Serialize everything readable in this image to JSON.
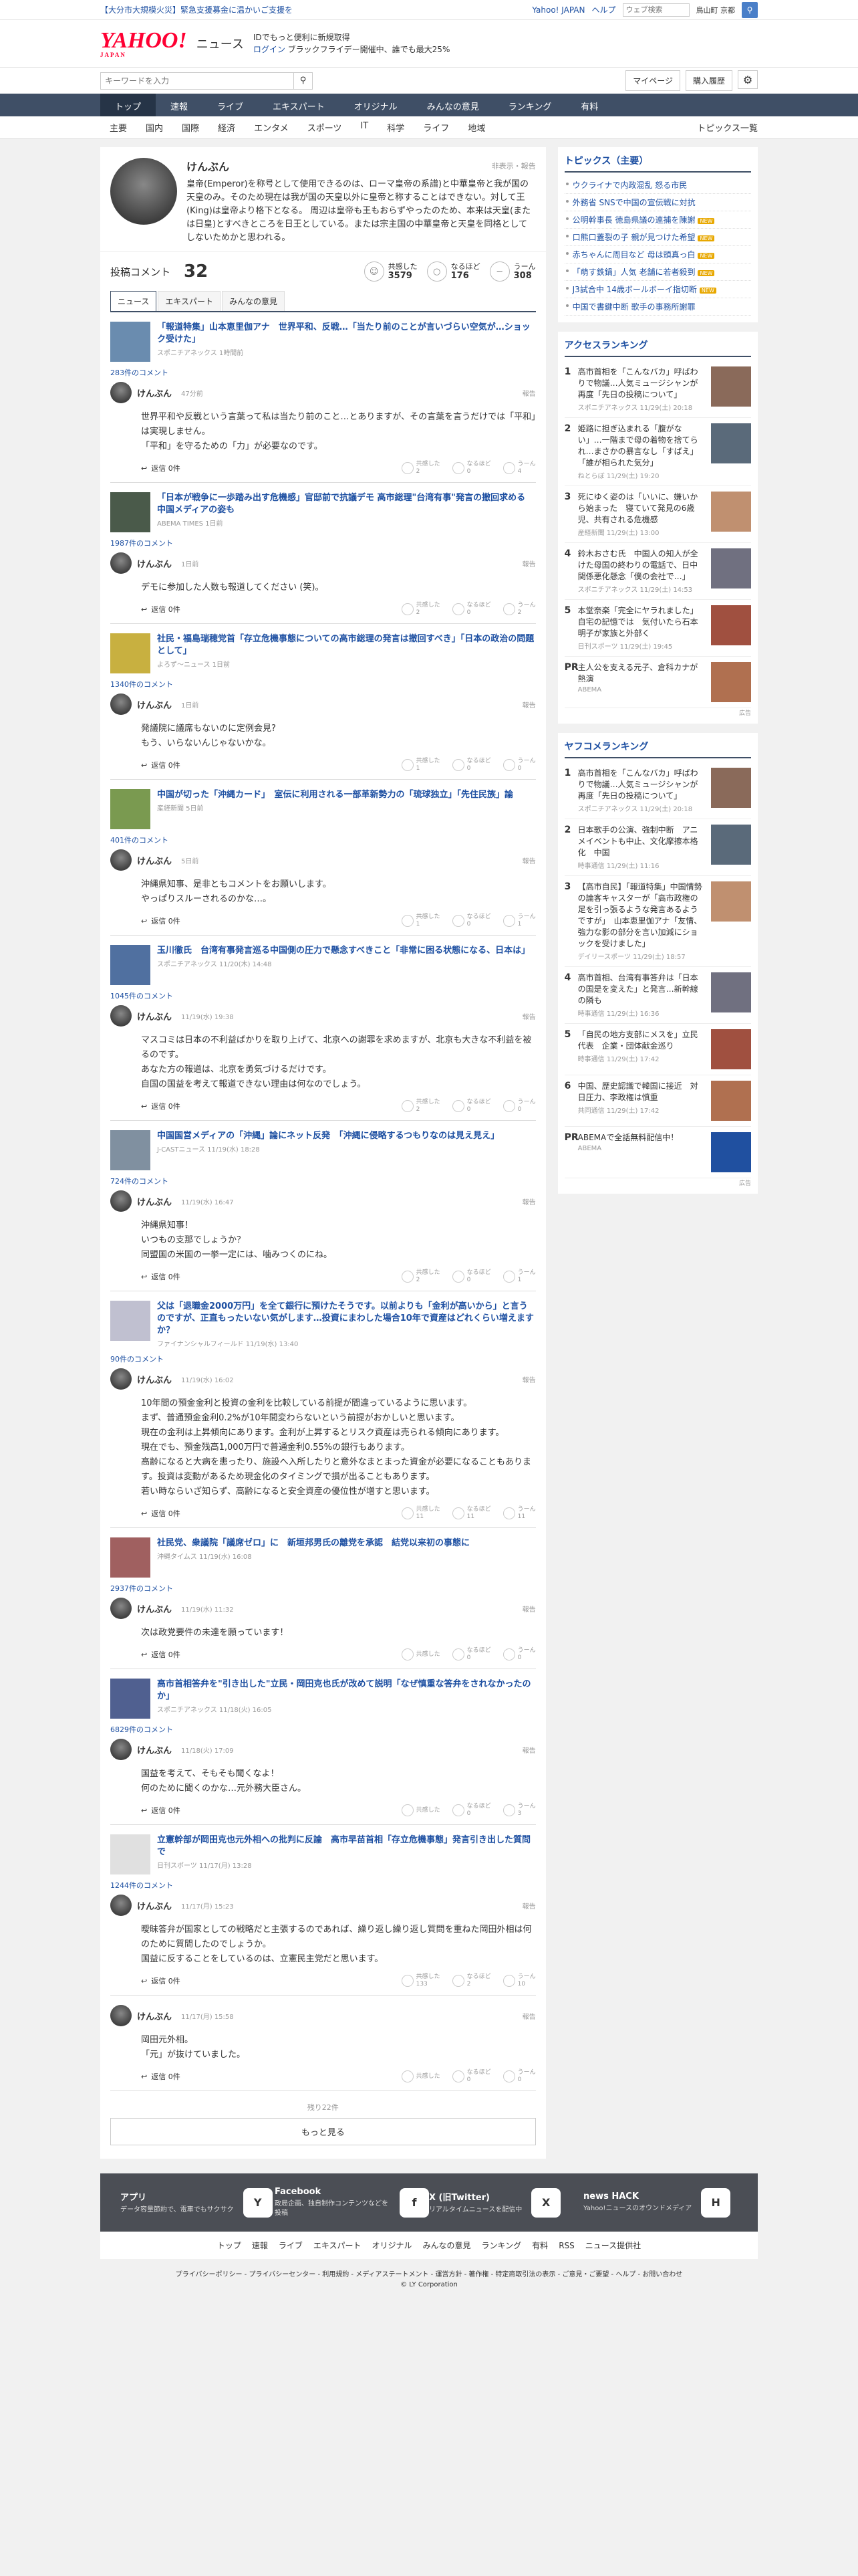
{
  "topbar": {
    "alert": "【大分市大規模火災】緊急支援募金に温かいご支援を",
    "yahoo_japan": "Yahoo! JAPAN",
    "help": "ヘルプ",
    "search_placeholder": "ウェブ検索",
    "weather": "鳥山町 京都"
  },
  "header": {
    "logo": "YAHOO!",
    "logo_sub": "JAPAN",
    "logo_news": "ニュース",
    "promo_line1": "IDでもっと便利に新規取得",
    "promo_login": "ログイン",
    "promo_line2": "ブラックフライデー開催中、誰でも最大25%"
  },
  "searchbar": {
    "placeholder": "キーワードを入力",
    "mypage": "マイページ",
    "history": "購入履歴"
  },
  "nav_main": [
    "トップ",
    "速報",
    "ライブ",
    "エキスパート",
    "オリジナル",
    "みんなの意見",
    "ランキング",
    "有料"
  ],
  "nav_sub": [
    "主要",
    "国内",
    "国際",
    "経済",
    "エンタメ",
    "スポーツ",
    "IT",
    "科学",
    "ライフ",
    "地域"
  ],
  "nav_sub_all": "トピックス一覧",
  "profile": {
    "name": "けんぶん",
    "report": "非表示・報告",
    "bio": "皇帝(Emperor)を称号として使用できるのは、ローマ皇帝の系譜)と中華皇帝と我が国の天皇のみ。そのため現在は我が国の天皇以外に皇帝と称することはできない。対して王(King)は皇帝より格下となる。 周辺は皇帝も王もおらずやったのため、本来は天皇(または日皇)とすべきところを日王としている。または宗主国の中華皇帝と天皇を同格としてしないためかと思われる。"
  },
  "stats": {
    "label": "投稿コメント",
    "count": "32",
    "kyokan_label": "共感した",
    "kyokan": "3579",
    "naruhodo_label": "なるほど",
    "naruhodo": "176",
    "uun_label": "うーん",
    "uun": "308"
  },
  "tabs": [
    "ニュース",
    "エキスパート",
    "みんなの意見"
  ],
  "vote_labels": {
    "a": "共感した",
    "b": "なるほど",
    "c": "うーん",
    "reply": "返信 0件",
    "report": "報告"
  },
  "cards": [
    {
      "title": "「報道特集」山本恵里伽アナ　世界平和、反戦…「当たり前のことが言いづらい空気が…ショック受けた」",
      "src": "スポニチアネックス 1時間前",
      "comments": "283件のコメント",
      "user": "けんぶん",
      "time": "47分前",
      "text": "世界平和や反戦という言葉って私は当たり前のこと…とありますが、その言葉を言うだけでは「平和」は実現しません。\n「平和」を守るための「力」が必要なのです。",
      "v1": "2",
      "v2": "0",
      "v3": "4"
    },
    {
      "title": "「日本が戦争に一歩踏み出す危機感」官邸前で抗議デモ 高市総理\"台湾有事\"発言の撤回求める 中国メディアの姿も",
      "src": "ABEMA TIMES 1日前",
      "comments": "1987件のコメント",
      "user": "けんぶん",
      "time": "1日前",
      "text": "デモに参加した人数も報道してください (笑)。",
      "v1": "2",
      "v2": "0",
      "v3": "2"
    },
    {
      "title": "社民・福島瑞穂党首「存立危機事態についての高市総理の発言は撤回すべき」「日本の政治の問題として」",
      "src": "よろず〜ニュース 1日前",
      "comments": "1340件のコメント",
      "user": "けんぶん",
      "time": "1日前",
      "text": "発議院に議席もないのに定例会見?\nもう、いらないんじゃないかな。",
      "v1": "1",
      "v2": "0",
      "v3": "0"
    },
    {
      "title": "中国が切った「沖縄カード」　室伝に利用される一部革新勢力の「琉球独立」「先住民族」論",
      "src": "産経新聞 5日前",
      "comments": "401件のコメント",
      "user": "けんぶん",
      "time": "5日前",
      "text": "沖縄県知事、是非ともコメントをお願いします。\nやっぱりスルーされるのかな…。",
      "v1": "1",
      "v2": "0",
      "v3": "1"
    },
    {
      "title": "玉川徹氏　台湾有事発言巡る中国側の圧力で懸念すべきこと「非常に困る状態になる、日本は」",
      "src": "スポニチアネックス 11/20(木) 14:48",
      "comments": "1045件のコメント",
      "user": "けんぶん",
      "time": "11/19(水) 19:38",
      "text": "マスコミは日本の不利益ばかりを取り上げて、北京への謝罪を求めますが、北京も大きな不利益を被るのです。\nあなた方の報道は、北京を勇気づけるだけです。\n自国の国益を考えて報道できない理由は何なのでしょう。",
      "v1": "2",
      "v2": "0",
      "v3": "0"
    },
    {
      "title": "中国国営メディアの「沖縄」論にネット反発　「沖縄に侵略するつもりなのは見え見え」",
      "src": "J-CASTニュース 11/19(水) 18:28",
      "comments": "724件のコメント",
      "user": "けんぶん",
      "time": "11/19(水) 16:47",
      "text": "沖縄県知事！\nいつもの支那でしょうか？\n同盟国の米国の一挙一定には、噛みつくのにね。",
      "v1": "2",
      "v2": "0",
      "v3": "1"
    },
    {
      "title": "父は「退職金2000万円」を全て銀行に預けたそうです。以前よりも「金利が高いから」と言うのですが、正直もったいない気がします…投資にまわした場合10年で資産はどれくらい増えますか？",
      "src": "ファイナンシャルフィールド 11/19(水) 13:40",
      "comments": "90件のコメント",
      "user": "けんぶん",
      "time": "11/19(水) 16:02",
      "text": "10年間の預金金利と投資の金利を比較している前提が間違っているように思います。\nまず、普通預金金利0.2%が10年間変わらないという前提がおかしいと思います。\n現在の金利は上昇傾向にあります。金利が上昇するとリスク資産は売られる傾向にあります。\n現在でも、預金残高1,000万円で普通金利0.55%の銀行もあります。\n高齢になると大病を患ったり、施設へ入所したりと意外なまとまった資金が必要になることもあります。投資は変動があるため現金化のタイミングで損が出ることもあります。\n若い時ならいざ知らず、高齢になると安全資産の優位性が増すと思います。",
      "v1": "11",
      "v2": "11",
      "v3": "11"
    },
    {
      "title": "社民党、衆議院「議席ゼロ」に　新垣邦男氏の離党を承認　結党以来初の事態に",
      "src": "沖縄タイムス 11/19(水) 16:08",
      "comments": "2937件のコメント",
      "user": "けんぶん",
      "time": "11/19(水) 11:32",
      "text": "次は政党要件の未達を願っています！",
      "v1": "",
      "v2": "0",
      "v3": "0"
    },
    {
      "title": "高市首相答弁を\"引き出した\"立民・岡田克也氏が改めて説明「なぜ慎重な答弁をされなかったのか」",
      "src": "スポニチアネックス 11/18(火) 16:05",
      "comments": "6829件のコメント",
      "user": "けんぶん",
      "time": "11/18(火) 17:09",
      "text": "国益を考えて、そもそも聞くなよ！\n何のために聞くのかな…元外務大臣さん。",
      "v1": "",
      "v2": "0",
      "v3": "3"
    },
    {
      "title": "立憲幹部が岡田克也元外相への批判に反論　高市早苗首相「存立危機事態」発言引き出した質問で",
      "src": "日刊スポーツ 11/17(月) 13:28",
      "comments": "1244件のコメント",
      "user": "けんぶん",
      "time": "11/17(月) 15:23",
      "text": "曖昧答弁が国家としての戦略だと主張するのであれば、繰り返し繰り返し質問を重ねた岡田外相は何のために質問したのでしょうか。\n国益に反することをしているのは、立憲民主党だと思います。",
      "v1": "133",
      "v2": "2",
      "v3": "10"
    },
    {
      "title": "",
      "src": "",
      "comments": "",
      "user": "けんぶん",
      "time": "11/17(月) 15:58",
      "text": "岡田元外相。\n「元」が抜けていました。",
      "v1": "",
      "v2": "0",
      "v3": "0"
    }
  ],
  "more": {
    "rest": "残り22件",
    "button": "もっと見る"
  },
  "side": {
    "topics_title": "トピックス（主要）",
    "topics": [
      "ウクライナで内政混乱 怒る市民",
      "外務省 SNSで中国の宣伝戦に対抗",
      "公明幹事長 徳島県議の連捕を陳謝",
      "口熊口蓋裂の子 親が見つけた希望",
      "赤ちゃんに周目など 母は頭真っ白",
      "「萌す鉄鍋」人気 老舗に若者殺到",
      "J3試合中 14歳ボールボーイ指切断",
      "中国で書鍵中断 歌手の事務所謝罪"
    ],
    "topics_new": [
      false,
      false,
      true,
      true,
      true,
      true,
      true,
      false
    ],
    "access_title": "アクセスランキング",
    "access": [
      {
        "t": "高市首相を「こんなバカ」呼ばわりで物議…人気ミュージシャンが再度「先日の投稿について」",
        "s": "スポニチアネックス 11/29(土) 20:18"
      },
      {
        "t": "姫路に担ぎ込まれる「腹がない」…一階まで母の着物を捨てられ…まさかの暴言なし「すばえ」「誰が相られた気分」",
        "s": "ねとらぼ 11/29(土) 19:20"
      },
      {
        "t": "死にゆく姿のは「いいに、嫌いから始まった　寝ていて発見の6歳児、共有される危機感",
        "s": "産経新聞 11/29(土) 13:00"
      },
      {
        "t": "鈴木おさむ氏　中国人の知人が全けた母国の終わりの電話で、日中関係悪化懸念「僕の会社で…」",
        "s": "スポニチアネックス 11/29(土) 14:53"
      },
      {
        "t": "本堂奈楽「完全にヤラれました」自宅の記憶では　気付いたら石本明子が家族と外部く",
        "s": "日刊スポーツ 11/29(土) 19:45"
      },
      {
        "t": "主人公を支える元子、倉科カナが熱演",
        "s": "ABEMA",
        "pr": true
      }
    ],
    "comment_rank_title": "ヤフコメランキング",
    "crank": [
      {
        "t": "高市首相を「こんなバカ」呼ばわりで物議…人気ミュージシャンが再度「先日の投稿について」",
        "s": "スポニチアネックス 11/29(土) 20:18"
      },
      {
        "t": "日本歌手の公演、強制中断　アニメイベントも中止、文化摩擦本格化　中国",
        "s": "時事通信 11/29(土) 11:16"
      },
      {
        "t": "【高市自民】「報道特集」中国情勢の論客キャスターが「高市政権の足を引っ張るような発言あるようですが」　山本恵里伽アナ「友情、強力な影の部分を言い加減にショックを受けました」",
        "s": "デイリースポーツ 11/29(土) 18:57"
      },
      {
        "t": "高市首相、台湾有事答弁は「日本の国是を変えた」と発言…新幹線の隣も",
        "s": "時事通信 11/29(土) 16:36"
      },
      {
        "t": "「自民の地方支部にメスを」立民代表　企業・団体献金巡り",
        "s": "時事通信 11/29(土) 17:42"
      },
      {
        "t": "中国、歴史認識で韓国に接近　対日圧力、李政権は慎重",
        "s": "共同通信 11/29(土) 17:42"
      },
      {
        "t": "ABEMAで全話無料配信中！",
        "s": "ABEMA",
        "pr": true
      }
    ],
    "ad": "広告"
  },
  "footer": [
    {
      "t": "アプリ",
      "d": "データ容量節約で、電車でもサクサク",
      "i": "Y"
    },
    {
      "t": "Facebook",
      "d": "政局企画、独自制作コンテンツなどを投稿",
      "i": "f"
    },
    {
      "t": "X (旧Twitter)",
      "d": "リアルタイムニュースを配信中",
      "i": "X"
    },
    {
      "t": "news HACK",
      "d": "Yahoo!ニュースのオウンドメディア",
      "i": "H"
    }
  ],
  "footnav": [
    "トップ",
    "速報",
    "ライブ",
    "エキスパート",
    "オリジナル",
    "みんなの意見",
    "ランキング",
    "有料",
    "RSS",
    "ニュース提供社"
  ],
  "footlinks": "プライバシーポリシー - プライバシーセンター - 利用規約 - メディアステートメント - 運営方針 - 著作権 - 特定商取引法の表示 - ご意見・ご要望 - ヘルプ - お問い合わせ",
  "copyright": "© LY Corporation"
}
